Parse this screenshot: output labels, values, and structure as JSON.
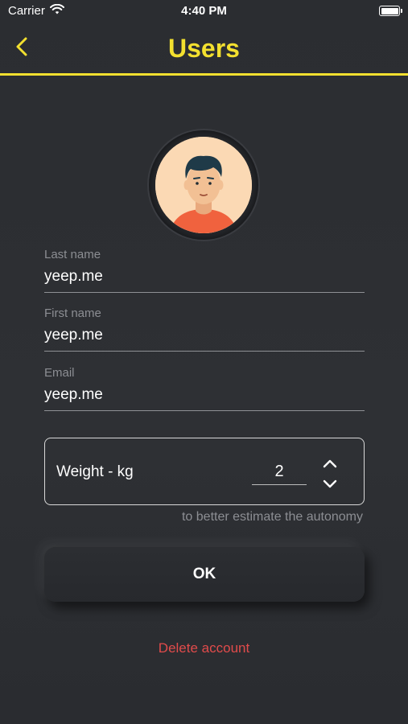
{
  "status_bar": {
    "carrier": "Carrier",
    "time": "4:40 PM"
  },
  "header": {
    "title": "Users"
  },
  "profile": {
    "avatar_icon": "avatar-icon",
    "fields": [
      {
        "label": "Last name",
        "value": "yeep.me"
      },
      {
        "label": "First name",
        "value": "yeep.me"
      },
      {
        "label": "Email",
        "value": "yeep.me"
      }
    ]
  },
  "weight": {
    "label": "Weight - kg",
    "value": "2",
    "hint": "to better estimate the autonomy"
  },
  "actions": {
    "ok_label": "OK",
    "delete_label": "Delete account"
  },
  "colors": {
    "accent": "#f3e02f",
    "danger": "#e14b4b",
    "background": "#2c2e32"
  }
}
